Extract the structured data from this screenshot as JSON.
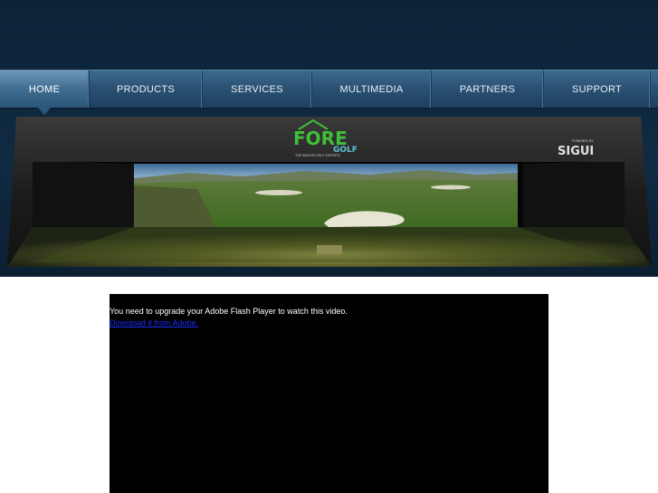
{
  "nav": {
    "items": [
      {
        "label": "HOME",
        "active": true
      },
      {
        "label": "PRODUCTS",
        "active": false
      },
      {
        "label": "SERVICES",
        "active": false
      },
      {
        "label": "MULTIMEDIA",
        "active": false
      },
      {
        "label": "PARTNERS",
        "active": false
      },
      {
        "label": "SUPPORT",
        "active": false
      }
    ]
  },
  "banner": {
    "logo_main": "FORE",
    "logo_sub": "GOLF",
    "logo_tagline": "THE INDOOR GOLF EXPERTS",
    "partner_small": "POWERED BY",
    "partner_logo": "SIGUI"
  },
  "video": {
    "message": "You need to upgrade your Adobe Flash Player to watch this video.",
    "link_text": "Download it from Adobe."
  },
  "colors": {
    "background_top": "#0f2a42",
    "nav_blue": "#2b5274",
    "logo_green": "#3fbf3a",
    "video_bg": "#000000",
    "link_blue": "#1a2cff"
  }
}
